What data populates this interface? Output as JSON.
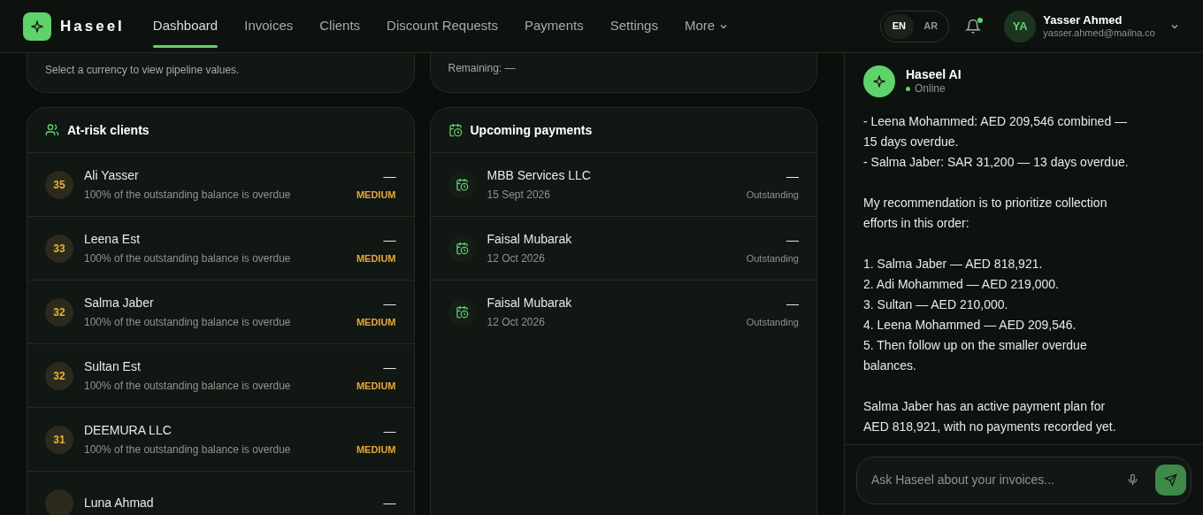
{
  "header": {
    "brand": "Haseel",
    "nav": [
      {
        "label": "Dashboard",
        "selected": true
      },
      {
        "label": "Invoices",
        "selected": false
      },
      {
        "label": "Clients",
        "selected": false
      },
      {
        "label": "Discount Requests",
        "selected": false
      },
      {
        "label": "Payments",
        "selected": false
      },
      {
        "label": "Settings",
        "selected": false
      },
      {
        "label": "More",
        "selected": false,
        "kind": "dropdown"
      }
    ],
    "languages": [
      {
        "label": "EN",
        "selected": true
      },
      {
        "label": "AR",
        "selected": false
      }
    ],
    "notifications": {
      "unread": true
    },
    "user": {
      "initials": "YA",
      "name": "Yasser Ahmed",
      "email": "yasser.ahmed@mailna.co"
    }
  },
  "top_cards": [
    {
      "text": "Select a currency to view pipeline values."
    },
    {
      "text": "Remaining: —"
    }
  ],
  "at_risk_clients": {
    "title": "At-risk clients",
    "rows": [
      {
        "score": "35",
        "name": "Ali Yasser",
        "detail": "100% of the outstanding balance is overdue",
        "amount": "—",
        "risk": "MEDIUM"
      },
      {
        "score": "33",
        "name": "Leena Est",
        "detail": "100% of the outstanding balance is overdue",
        "amount": "—",
        "risk": "MEDIUM"
      },
      {
        "score": "32",
        "name": "Salma Jaber",
        "detail": "100% of the outstanding balance is overdue",
        "amount": "—",
        "risk": "MEDIUM"
      },
      {
        "score": "32",
        "name": "Sultan Est",
        "detail": "100% of the outstanding balance is overdue",
        "amount": "—",
        "risk": "MEDIUM"
      },
      {
        "score": "31",
        "name": "DEEMURA LLC",
        "detail": "100% of the outstanding balance is overdue",
        "amount": "—",
        "risk": "MEDIUM"
      },
      {
        "name": "Luna Ahmad",
        "amount": "—"
      }
    ]
  },
  "upcoming_payments": {
    "title": "Upcoming payments",
    "rows": [
      {
        "name": "MBB Services LLC",
        "date": "15 Sept 2026",
        "amount": "—",
        "status": "Outstanding"
      },
      {
        "name": "Faisal Mubarak",
        "date": "12 Oct 2026",
        "amount": "—",
        "status": "Outstanding"
      },
      {
        "name": "Faisal Mubarak",
        "date": "12 Oct 2026",
        "amount": "—",
        "status": "Outstanding"
      }
    ]
  },
  "assistant": {
    "name": "Haseel AI",
    "status": "Online",
    "online": true,
    "paragraphs": [
      [
        "- Leena Mohammed: AED 209,546 combined — 15 days overdue.",
        "- Salma Jaber: SAR 31,200 — 13 days overdue."
      ],
      [
        "My recommendation is to prioritize collection efforts in this order:"
      ],
      [
        "1. Salma Jaber — AED 818,921.",
        "2. Adi Mohammed — AED 219,000.",
        "3. Sultan — AED 210,000.",
        "4. Leena Mohammed — AED 209,546.",
        "5. Then follow up on the smaller overdue balances."
      ],
      [
        "Salma Jaber has an active payment plan for AED 818,921, with no payments recorded yet."
      ]
    ],
    "input": {
      "placeholder": "Ask Haseel about your invoices..."
    }
  }
}
